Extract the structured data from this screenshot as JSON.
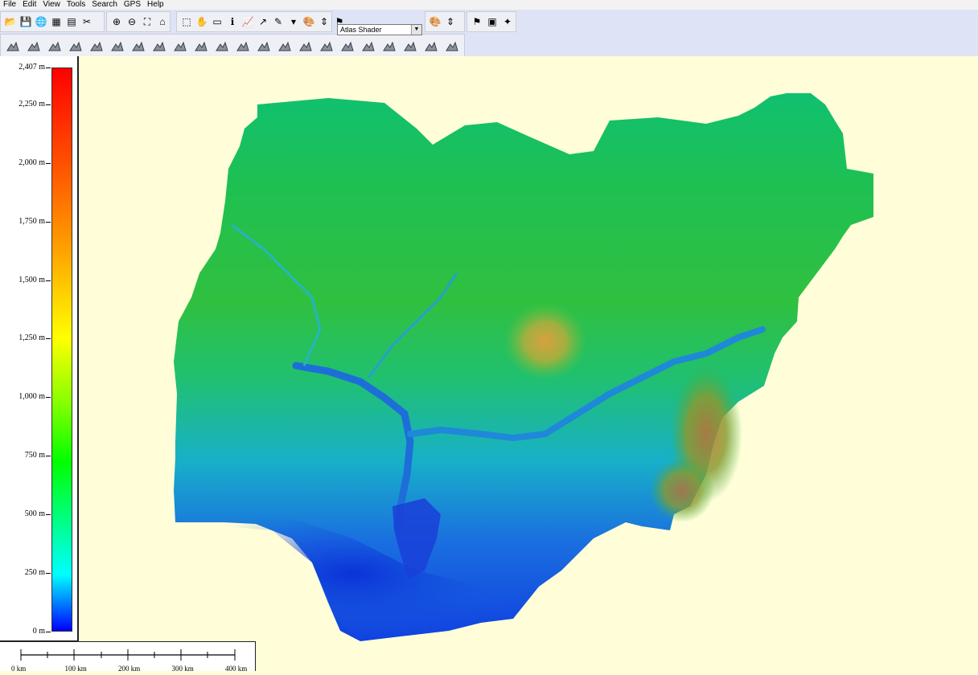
{
  "menu": [
    "File",
    "Edit",
    "View",
    "Tools",
    "Search",
    "GPS",
    "Help"
  ],
  "toolbar": {
    "shader_select": "Atlas Shader",
    "row1_icons": [
      "open-folder-icon",
      "save-icon",
      "globe-icon",
      "layers-icon",
      "properties-icon",
      "tools-icon",
      "zoom-in-icon",
      "zoom-out-icon",
      "zoom-full-icon",
      "home-icon",
      "select-icon",
      "pan-icon",
      "measure-icon",
      "info-icon",
      "graph-icon",
      "path-icon",
      "digitize-icon",
      "dropdown-icon",
      "shader-icon",
      "vertical-exaggeration-icon",
      "label-icon",
      "screen-icon",
      "star-icon"
    ],
    "row2_icons": [
      "terrain-shade-icon",
      "terrain-slope-icon",
      "terrain-aspect-icon",
      "terrain-contour-icon",
      "terrain-profile-icon",
      "terrain-view-icon",
      "terrain-watershed-icon",
      "terrain-grid-icon",
      "terrain-combine-icon",
      "terrain-flat-icon",
      "terrain-cut-icon",
      "terrain-fill-icon",
      "terrain-line-icon",
      "terrain-spot-icon",
      "terrain-curve-icon",
      "terrain-ridge-icon",
      "terrain-flow-icon",
      "terrain-basin-icon",
      "terrain-summit-icon",
      "terrain-zone-icon",
      "terrain-blend-icon",
      "terrain-shape-icon"
    ]
  },
  "legend": {
    "unit": "m",
    "labels": [
      "2,407 m",
      "2,250 m",
      "2,000 m",
      "1,750 m",
      "1,500 m",
      "1,250 m",
      "1,000 m",
      "750 m",
      "500 m",
      "250 m",
      "0 m"
    ],
    "values": [
      2407,
      2250,
      2000,
      1750,
      1500,
      1250,
      1000,
      750,
      500,
      250,
      0
    ],
    "max": 2407,
    "colors": [
      "#0000ff",
      "#00ffff",
      "#00ff80",
      "#00ff00",
      "#80ff00",
      "#ffff00",
      "#ffa000",
      "#ff0000"
    ]
  },
  "scale": {
    "labels": [
      "0 km",
      "100 km",
      "200 km",
      "300 km",
      "400 km"
    ],
    "values_km": [
      0,
      100,
      200,
      300,
      400
    ]
  },
  "map": {
    "background": "#fffed8",
    "low_color": "#1030d8",
    "high_color": "#c08030"
  }
}
